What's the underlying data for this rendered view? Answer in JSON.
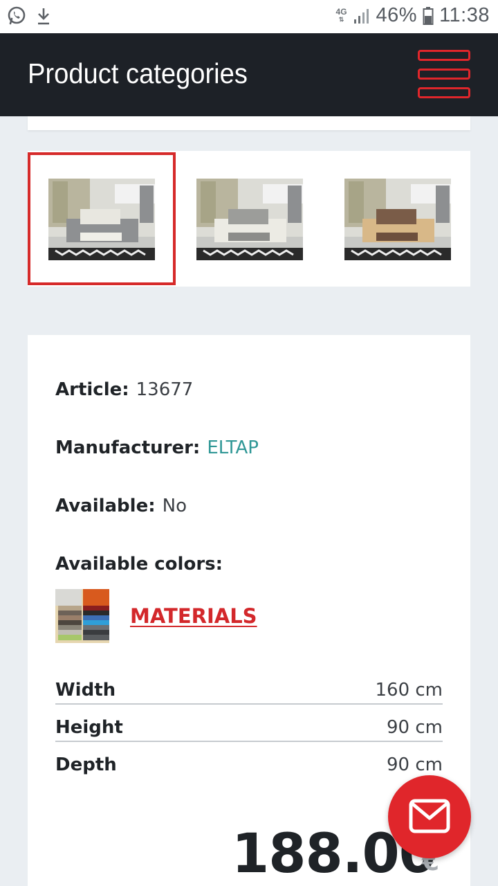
{
  "status_bar": {
    "network": "4G",
    "battery": "46%",
    "time": "11:38",
    "left_icons": [
      "whatsapp-icon",
      "download-icon"
    ]
  },
  "header": {
    "title": "Product categories",
    "menu_icon": "hamburger-menu-icon",
    "accent_color": "#e0262b",
    "background": "#1d2127"
  },
  "gallery": {
    "thumbnails": [
      {
        "name": "sofa-grey-white",
        "selected": true
      },
      {
        "name": "sofa-white-grey",
        "selected": false
      },
      {
        "name": "sofa-beige-brown",
        "selected": false
      }
    ],
    "selected_border_color": "#d62a2a"
  },
  "details": {
    "article_label": "Article:",
    "article_value": "13677",
    "manufacturer_label": "Manufacturer:",
    "manufacturer_value": "ELTAP",
    "available_label": "Available:",
    "available_value": "No",
    "colors_label": "Available colors:",
    "materials_link": "MATERIALS"
  },
  "specs": [
    {
      "key": "Width",
      "value": "160 cm"
    },
    {
      "key": "Height",
      "value": "90 cm"
    },
    {
      "key": "Depth",
      "value": "90 cm"
    }
  ],
  "price": {
    "amount": "188.00",
    "currency": "€"
  },
  "fab": {
    "icon": "mail-icon"
  }
}
